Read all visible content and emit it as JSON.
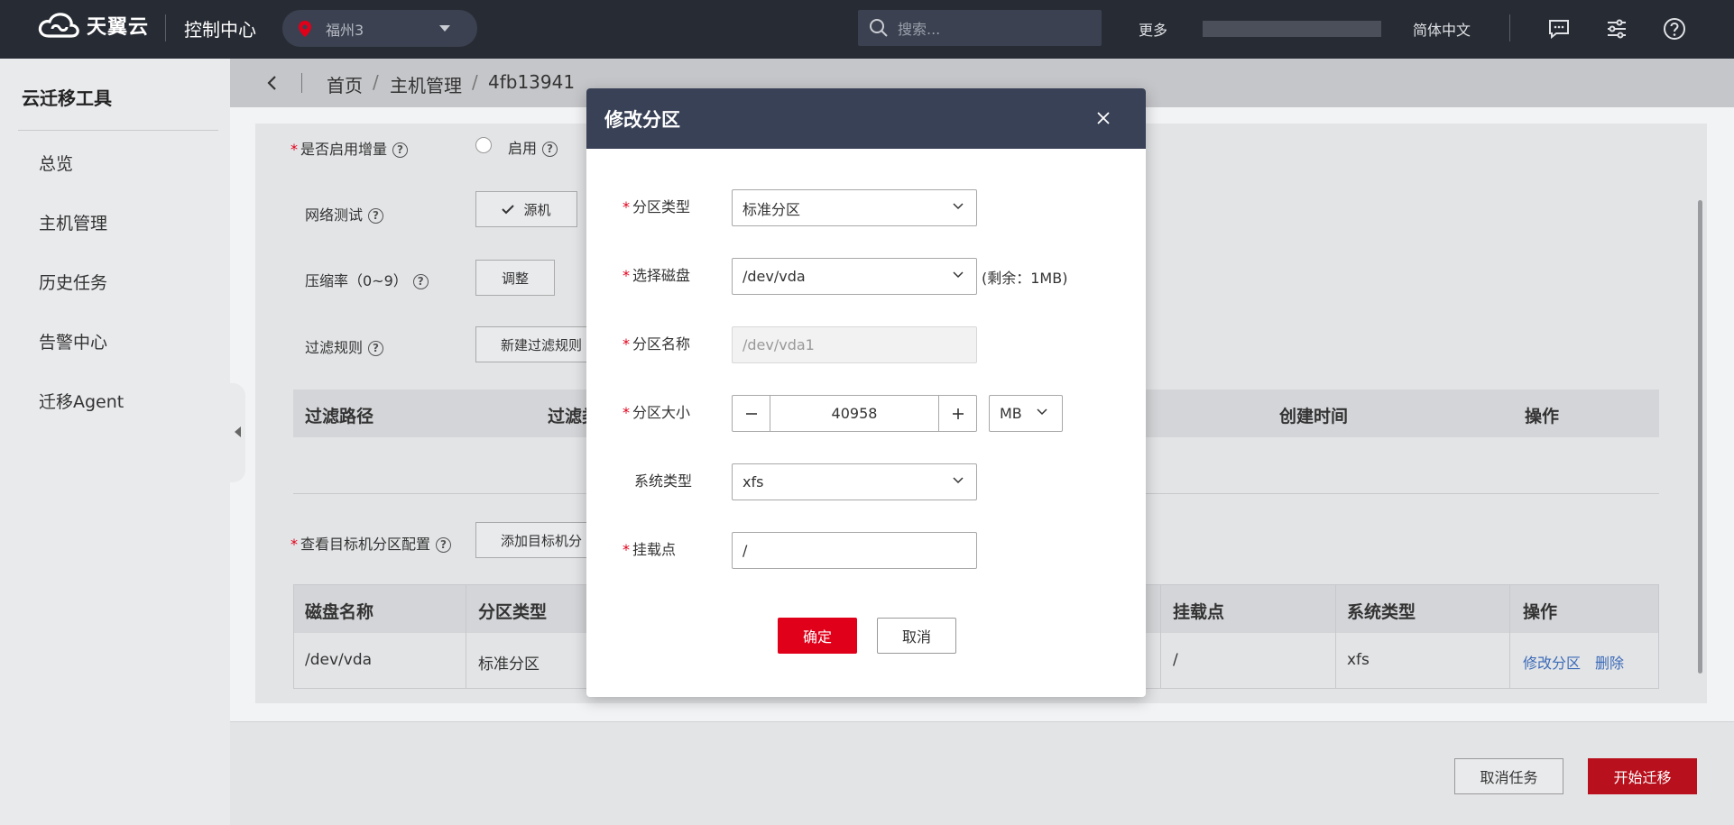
{
  "header": {
    "logo_text": "天翼云",
    "console": "控制中心",
    "region": "福州3",
    "search_placeholder": "搜索...",
    "more": "更多",
    "language": "简体中文"
  },
  "sidebar": {
    "title": "云迁移工具",
    "items": [
      {
        "label": "总览"
      },
      {
        "label": "主机管理"
      },
      {
        "label": "历史任务"
      },
      {
        "label": "告警中心"
      },
      {
        "label": "迁移Agent"
      }
    ]
  },
  "breadcrumb": {
    "home": "首页",
    "hosts": "主机管理",
    "current": "4fb13941",
    "separator": "/"
  },
  "form": {
    "incremental_label": "是否启用增量",
    "incremental_option": "启用",
    "network_label": "网络测试",
    "network_button": "源机",
    "compress_label": "压缩率（0~9）",
    "compress_button": "调整",
    "filter_label": "过滤规则",
    "filter_button": "新建过滤规则",
    "filter_table_headers": [
      "过滤路径",
      "过滤类",
      "创建时间",
      "操作"
    ],
    "partition_label": "查看目标机分区配置",
    "partition_button": "添加目标机分",
    "partition_table_headers": [
      "磁盘名称",
      "分区类型",
      "挂载点",
      "系统类型",
      "操作"
    ],
    "partition_rows": [
      {
        "disk": "/dev/vda",
        "type": "标准分区",
        "mount": "/",
        "fs": "xfs",
        "edit": "修改分区",
        "delete": "删除"
      }
    ]
  },
  "footer": {
    "cancel_task": "取消任务",
    "start": "开始迁移"
  },
  "modal": {
    "title": "修改分区",
    "partition_type_label": "分区类型",
    "partition_type_value": "标准分区",
    "disk_label": "选择磁盘",
    "disk_value": "/dev/vda",
    "disk_hint": "(剩余：1MB)",
    "name_label": "分区名称",
    "name_value": "/dev/vda1",
    "size_label": "分区大小",
    "size_value": "40958",
    "size_unit": "MB",
    "fs_label": "系统类型",
    "fs_value": "xfs",
    "mount_label": "挂载点",
    "mount_value": "/",
    "ok": "确定",
    "cancel": "取消"
  },
  "colors": {
    "topbar": "#272b33",
    "primary_red": "#e0001a",
    "link_blue": "#3c6bb8",
    "modal_header": "#394156"
  }
}
